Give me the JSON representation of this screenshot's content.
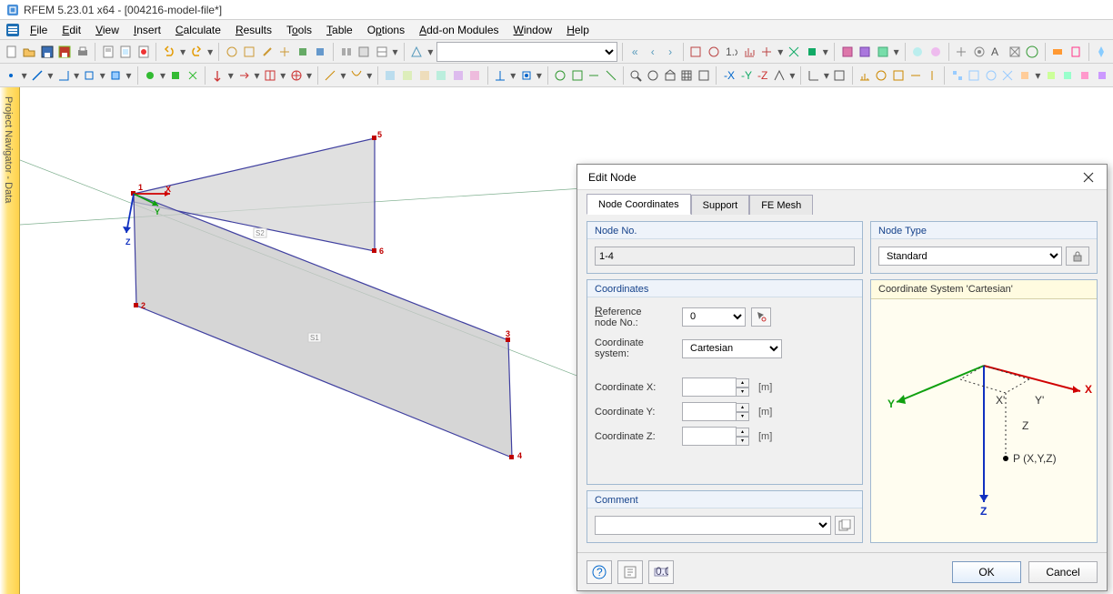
{
  "title": "RFEM 5.23.01 x64 - [004216-model-file*]",
  "menu": {
    "file": "File",
    "edit": "Edit",
    "view": "View",
    "insert": "Insert",
    "calculate": "Calculate",
    "results": "Results",
    "tools": "Tools",
    "table": "Table",
    "options": "Options",
    "addon": "Add-on Modules",
    "window": "Window",
    "help": "Help"
  },
  "sidetab": "Project Navigator - Data",
  "canvas": {
    "nodes": {
      "n1": "1",
      "n2": "2",
      "n3": "3",
      "n4": "4",
      "n5": "5",
      "n6": "6"
    },
    "surfaces": {
      "s1": "S1",
      "s2": "S2"
    },
    "axes": {
      "x": "X",
      "y": "Y",
      "z": "Z"
    }
  },
  "dialog": {
    "title": "Edit Node",
    "tabs": {
      "coords": "Node Coordinates",
      "support": "Support",
      "femesh": "FE Mesh"
    },
    "node_no": {
      "title": "Node No.",
      "value": "1-4"
    },
    "node_type": {
      "title": "Node Type",
      "value": "Standard"
    },
    "coordinates": {
      "title": "Coordinates",
      "ref_label": "Reference node No.:",
      "ref_value": "0",
      "sys_label": "Coordinate system:",
      "sys_value": "Cartesian",
      "x_label": "Coordinate X:",
      "y_label": "Coordinate Y:",
      "z_label": "Coordinate Z:",
      "x_value": "",
      "y_value": "",
      "z_value": "",
      "unit": "[m]"
    },
    "csys_title": "Coordinate System 'Cartesian'",
    "csys_axes": {
      "x": "X",
      "y": "Y",
      "z": "Z",
      "gx": "X'",
      "gy": "Y'",
      "gz": "Z",
      "point": "P (X,Y,Z)"
    },
    "comment": {
      "title": "Comment",
      "value": ""
    },
    "ok": "OK",
    "cancel": "Cancel"
  }
}
